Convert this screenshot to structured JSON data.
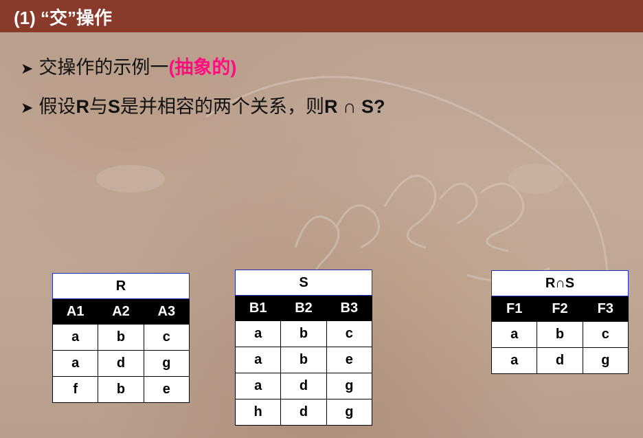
{
  "title": "(1) “交”操作",
  "bullets": {
    "line1_text": "交操作的示例一",
    "line1_highlight": "(抽象的)",
    "line2_pre": "假设",
    "line2_r": "R",
    "line2_mid": "与",
    "line2_s": "S",
    "line2_post": "是并相容的两个关系，则",
    "line2_expr": "R ∩ S?"
  },
  "colors": {
    "title_bar": "#8a3a2a",
    "highlight": "#ff0d7e",
    "table_header": "#000000",
    "caption_border": "#1a2fbf"
  },
  "tables": {
    "r": {
      "caption": "R",
      "headers": [
        "A1",
        "A2",
        "A3"
      ],
      "rows": [
        [
          "a",
          "b",
          "c"
        ],
        [
          "a",
          "d",
          "g"
        ],
        [
          "f",
          "b",
          "e"
        ]
      ]
    },
    "s": {
      "caption": "S",
      "headers": [
        "B1",
        "B2",
        "B3"
      ],
      "rows": [
        [
          "a",
          "b",
          "c"
        ],
        [
          "a",
          "b",
          "e"
        ],
        [
          "a",
          "d",
          "g"
        ],
        [
          "h",
          "d",
          "g"
        ]
      ]
    },
    "rs": {
      "caption": "R∩S",
      "headers": [
        "F1",
        "F2",
        "F3"
      ],
      "rows": [
        [
          "a",
          "b",
          "c"
        ],
        [
          "a",
          "d",
          "g"
        ]
      ]
    }
  }
}
